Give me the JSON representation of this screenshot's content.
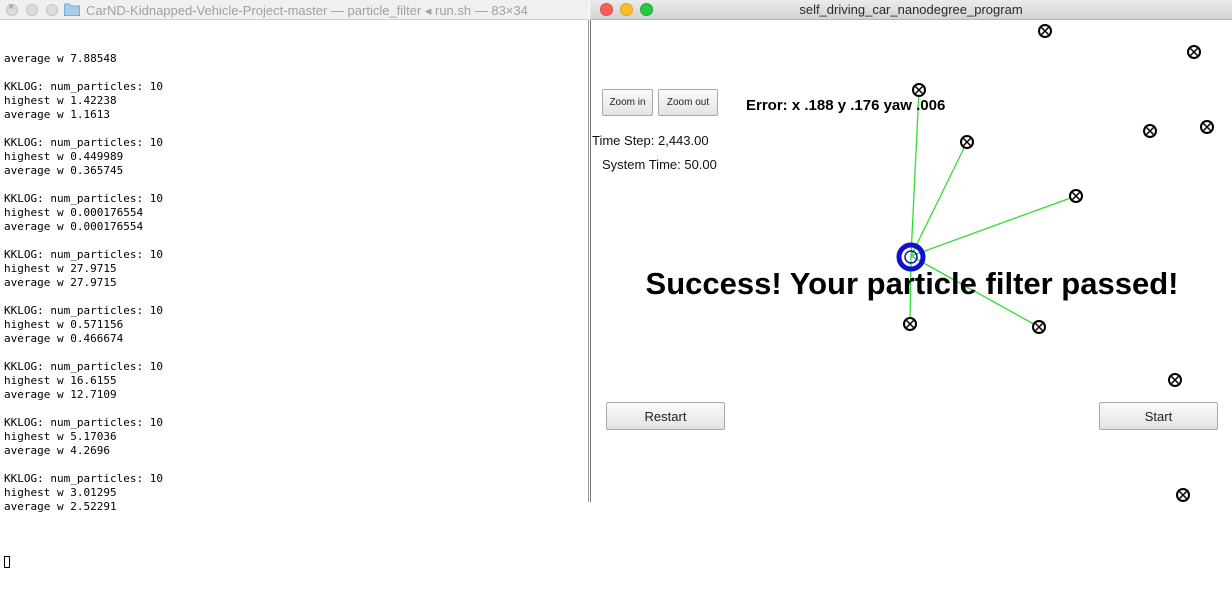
{
  "terminal": {
    "title": "CarND-Kidnapped-Vehicle-Project-master — particle_filter ◂ run.sh — 83×34",
    "lines": [
      "average w 7.88548",
      "",
      "KKLOG: num_particles: 10",
      "highest w 1.42238",
      "average w 1.1613",
      "",
      "KKLOG: num_particles: 10",
      "highest w 0.449989",
      "average w 0.365745",
      "",
      "KKLOG: num_particles: 10",
      "highest w 0.000176554",
      "average w 0.000176554",
      "",
      "KKLOG: num_particles: 10",
      "highest w 27.9715",
      "average w 27.9715",
      "",
      "KKLOG: num_particles: 10",
      "highest w 0.571156",
      "average w 0.466674",
      "",
      "KKLOG: num_particles: 10",
      "highest w 16.6155",
      "average w 12.7109",
      "",
      "KKLOG: num_particles: 10",
      "highest w 5.17036",
      "average w 4.2696",
      "",
      "KKLOG: num_particles: 10",
      "highest w 3.01295",
      "average w 2.52291",
      ""
    ]
  },
  "simulator": {
    "title": "self_driving_car_nanodegree_program",
    "zoom_in_label": "Zoom in",
    "zoom_out_label": "Zoom out",
    "error_text": "Error: x .188 y .176 yaw .006",
    "time_step": "Time Step: 2,443.00",
    "system_time": "System Time: 50.00",
    "success_message": "Success! Your particle filter passed!",
    "restart_label": "Restart",
    "start_label": "Start",
    "colors": {
      "landmark": "#000000",
      "observation_line": "#33dd33",
      "vehicle": "#1010cc",
      "close_button": "#fc5f57",
      "minimize_button": "#fdbc2e",
      "zoom_button": "#28c840"
    },
    "icons": {
      "landmark": "circled-x-icon",
      "vehicle": "ring-icon"
    }
  }
}
